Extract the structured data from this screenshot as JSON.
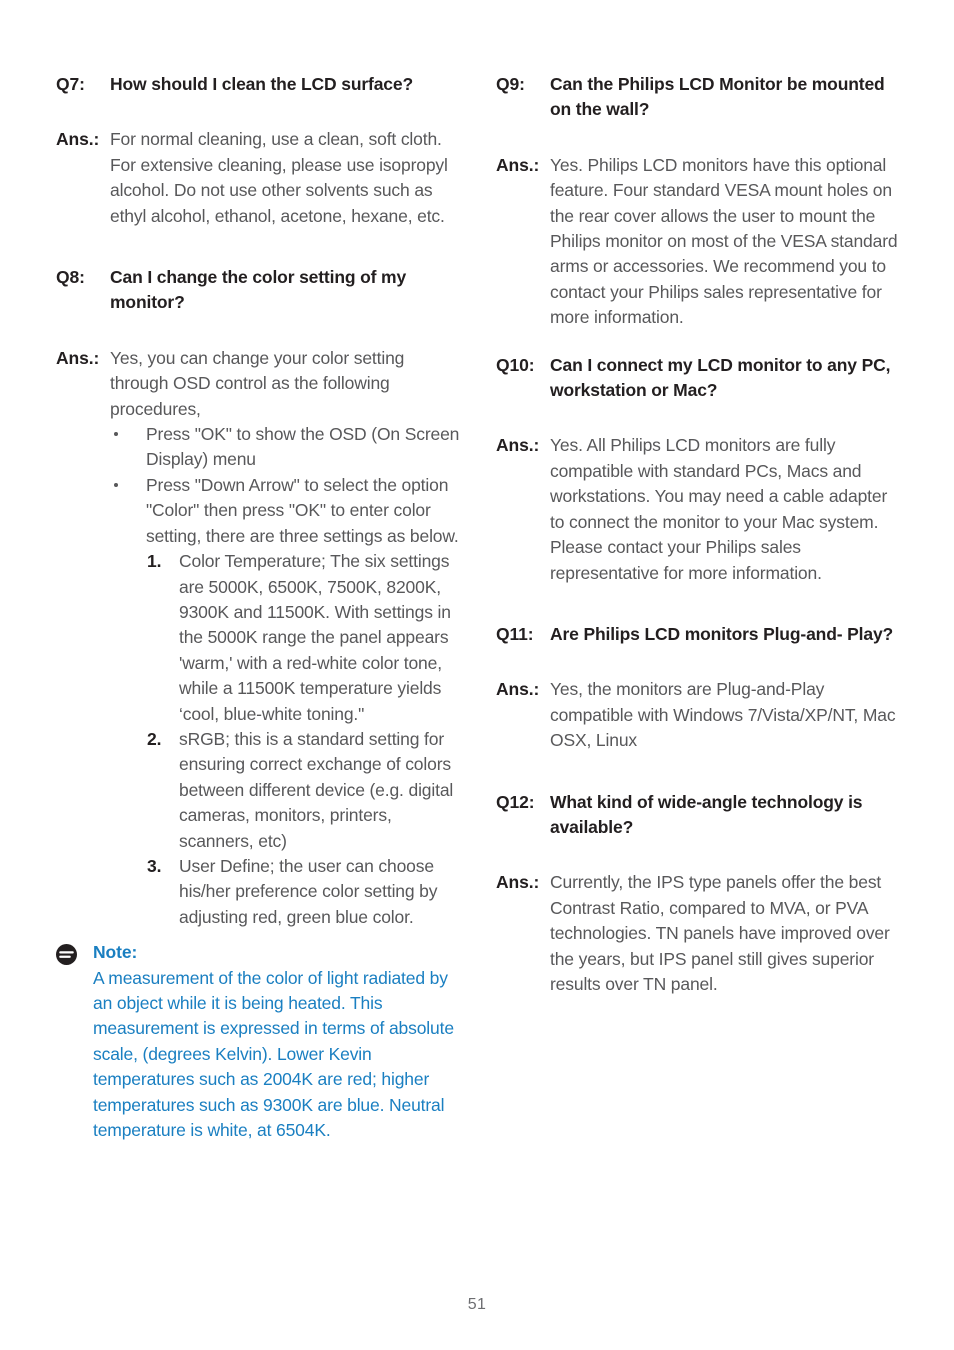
{
  "page": {
    "number": "51",
    "note_color": "#1a7fc1",
    "heading_color": "#231f20",
    "body_color": "#58585a"
  },
  "left_column": {
    "q7": {
      "label": "Q7:",
      "question": "How should I clean the LCD surface?",
      "ans_label": "Ans.:",
      "answer": "For normal cleaning, use a clean, soft cloth. For extensive cleaning, please use isopropyl alcohol. Do not use other solvents such as ethyl alcohol, ethanol, acetone, hexane, etc."
    },
    "q8": {
      "label": "Q8:",
      "question": "Can I change the color setting of my monitor?",
      "ans_label": "Ans.:",
      "answer": "Yes, you can change your color setting through OSD control as the following procedures,",
      "bullets": [
        "Press \"OK\" to show the OSD (On Screen Display) menu",
        "Press \"Down Arrow\" to select the option \"Color\" then press \"OK\" to enter color setting, there are three settings as below."
      ],
      "numbered": [
        {
          "num": "1.",
          "text": "Color Temperature; The six settings are 5000K, 6500K, 7500K, 8200K, 9300K and 11500K. With settings in the 5000K range the panel appears 'warm,' with a red-white color tone, while a 11500K temperature yields ‘cool, blue-white toning.\""
        },
        {
          "num": "2.",
          "text": "sRGB; this is a standard setting for ensuring correct exchange of colors between different device (e.g. digital cameras, monitors, printers, scanners, etc)"
        },
        {
          "num": "3.",
          "text": "User Define; the user can choose his/her preference color setting by adjusting red, green blue color."
        }
      ]
    },
    "note": {
      "icon": "note-icon",
      "title": "Note:",
      "text": "A measurement of the color of light radiated by an object while it is being heated. This measurement is expressed in terms of absolute scale, (degrees Kelvin). Lower Kevin temperatures such as 2004K are red; higher temperatures such as 9300K are blue. Neutral temperature is white, at 6504K."
    }
  },
  "right_column": {
    "q9": {
      "label": "Q9:",
      "question": "Can the Philips LCD Monitor be mounted on the wall?",
      "ans_label": "Ans.:",
      "answer": "Yes. Philips LCD monitors have this optional feature. Four standard VESA mount holes on the rear cover allows the user to mount the Philips monitor on most of the VESA standard arms or accessories. We recommend you to contact your Philips sales representative for more information."
    },
    "q10": {
      "label": "Q10:",
      "question": "Can I connect my LCD monitor to any PC, workstation or Mac?",
      "ans_label": "Ans.:",
      "answer": "Yes. All Philips LCD monitors are fully compatible with standard PCs, Macs and workstations. You may need a cable adapter to connect the monitor to your Mac system. Please contact your Philips sales representative for more information."
    },
    "q11": {
      "label": "Q11:",
      "question": "Are Philips LCD monitors Plug-and- Play?",
      "ans_label": "Ans.:",
      "answer": "Yes, the monitors are Plug-and-Play compatible with Windows 7/Vista/XP/NT, Mac OSX, Linux"
    },
    "q12": {
      "label": "Q12:",
      "question": "What kind of wide-angle technology is available?",
      "ans_label": "Ans.:",
      "answer": "Currently, the IPS type panels offer the best Contrast Ratio, compared to MVA, or PVA technologies.  TN panels have improved over the years, but IPS panel still gives superior results over TN panel."
    }
  }
}
